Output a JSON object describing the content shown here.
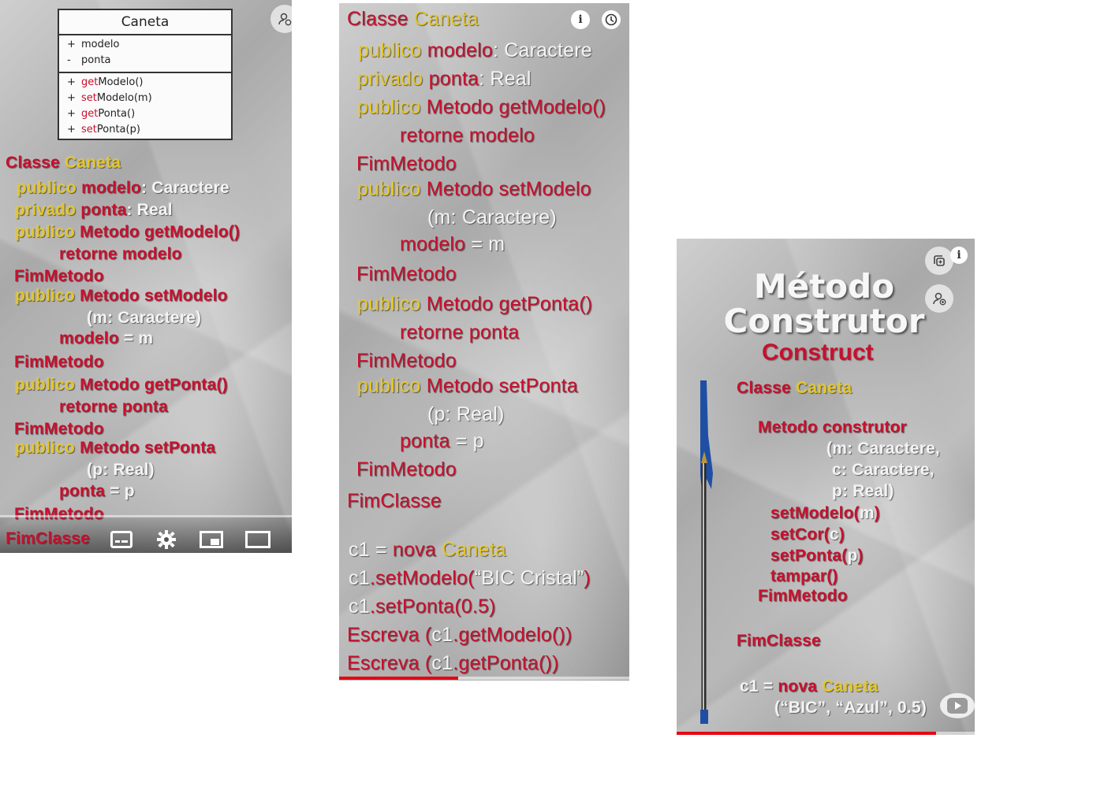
{
  "panel1": {
    "uml": {
      "title": "Caneta",
      "attributes": [
        {
          "sign": "+",
          "name": "modelo"
        },
        {
          "sign": "-",
          "name": "ponta"
        }
      ],
      "methods": [
        {
          "sign": "+",
          "prefix": "get",
          "rest": "Modelo()"
        },
        {
          "sign": "+",
          "prefix": "set",
          "rest": "Modelo(m)"
        },
        {
          "sign": "+",
          "prefix": "get",
          "rest": "Ponta()"
        },
        {
          "sign": "+",
          "prefix": "set",
          "rest": "Ponta(p)"
        }
      ]
    },
    "code": {
      "l1a": "Classe",
      "l1b": "Caneta",
      "l2a": "publico",
      "l2b": "modelo",
      "l2c": ": Caractere",
      "l3a": "privado",
      "l3b": "ponta",
      "l3c": ": Real",
      "l4a": "publico",
      "l4b": "Metodo",
      "l4c": "getModelo()",
      "l5a": "retorne",
      "l5b": "modelo",
      "l6": "FimMetodo",
      "l7a": "publico",
      "l7b": "Metodo",
      "l7c": "setModelo",
      "l8": "(m: Caractere)",
      "l9a": "modelo",
      "l9b": "= m",
      "l10": "FimMetodo",
      "l11a": "publico",
      "l11b": "Metodo",
      "l11c": "getPonta()",
      "l12a": "retorne",
      "l12b": "ponta",
      "l13": "FimMetodo",
      "l14a": "publico",
      "l14b": "Metodo",
      "l14c": "setPonta",
      "l15": "(p: Real)",
      "l16a": "ponta",
      "l16b": "= p",
      "l17": "FimMetodo",
      "l18": "FimClasse"
    },
    "controls": [
      "captions-icon",
      "settings-icon",
      "miniplayer-icon",
      "theater-icon"
    ]
  },
  "panel2": {
    "code": {
      "l1a": "Classe",
      "l1b": "Caneta",
      "l2a": "publico",
      "l2b": "modelo",
      "l2c": ": Caractere",
      "l3a": "privado",
      "l3b": "ponta",
      "l3c": ": Real",
      "l4a": "publico",
      "l4b": "Metodo",
      "l4c": "getModelo()",
      "l5a": "retorne",
      "l5b": "modelo",
      "l6": "FimMetodo",
      "l7a": "publico",
      "l7b": "Metodo",
      "l7c": "setModelo",
      "l8": "(m: Caractere)",
      "l9a": "modelo",
      "l9b": "= m",
      "l10": "FimMetodo",
      "l11a": "publico",
      "l11b": "Metodo",
      "l11c": "getPonta()",
      "l12a": "retorne",
      "l12b": "ponta",
      "l13": "FimMetodo",
      "l14a": "publico",
      "l14b": "Metodo",
      "l14c": "setPonta",
      "l15": "(p: Real)",
      "l16a": "ponta",
      "l16b": "= p",
      "l17": "FimMetodo",
      "l18": "FimClasse",
      "l19a": "c1",
      "l19b": "= ",
      "l19c": "nova",
      "l19d": "Caneta",
      "l20a": "c1",
      "l20b": ".setModelo(",
      "l20c": "“BIC Cristal”",
      "l20d": ")",
      "l21a": "c1",
      "l21b": ".setPonta(0.5)",
      "l22a": "Escreva (",
      "l22b": "c1",
      "l22c": ".getModelo())",
      "l23a": "Escreva (",
      "l23b": "c1",
      "l23c": ".getPonta())"
    },
    "progress": 0.41
  },
  "panel3": {
    "title1": "Método",
    "title2": "Construtor",
    "subtitle": "Construct",
    "code": {
      "l1a": "Classe",
      "l1b": "Caneta",
      "l2a": "Metodo",
      "l2b": "construtor",
      "l3": "(m: Caractere,",
      "l4": "c: Caractere,",
      "l5": "p: Real)",
      "l6a": "setModelo(",
      "l6b": "m",
      "l6c": ")",
      "l7a": "setCor(",
      "l7b": "c",
      "l7c": ")",
      "l8a": "setPonta(",
      "l8b": "p",
      "l8c": ")",
      "l9": "tampar()",
      "l10": "FimMetodo",
      "l11": "FimClasse",
      "l12a": "c1",
      "l12b": "= ",
      "l12c": "nova",
      "l12d": "Caneta",
      "l13": "(“BIC”, “Azul”, 0.5)"
    },
    "progress": 0.87
  },
  "colors": {
    "keyword": "#e3c62b",
    "identifier": "#c8102e",
    "value": "#f4f4f4",
    "progress": "#e50914"
  }
}
